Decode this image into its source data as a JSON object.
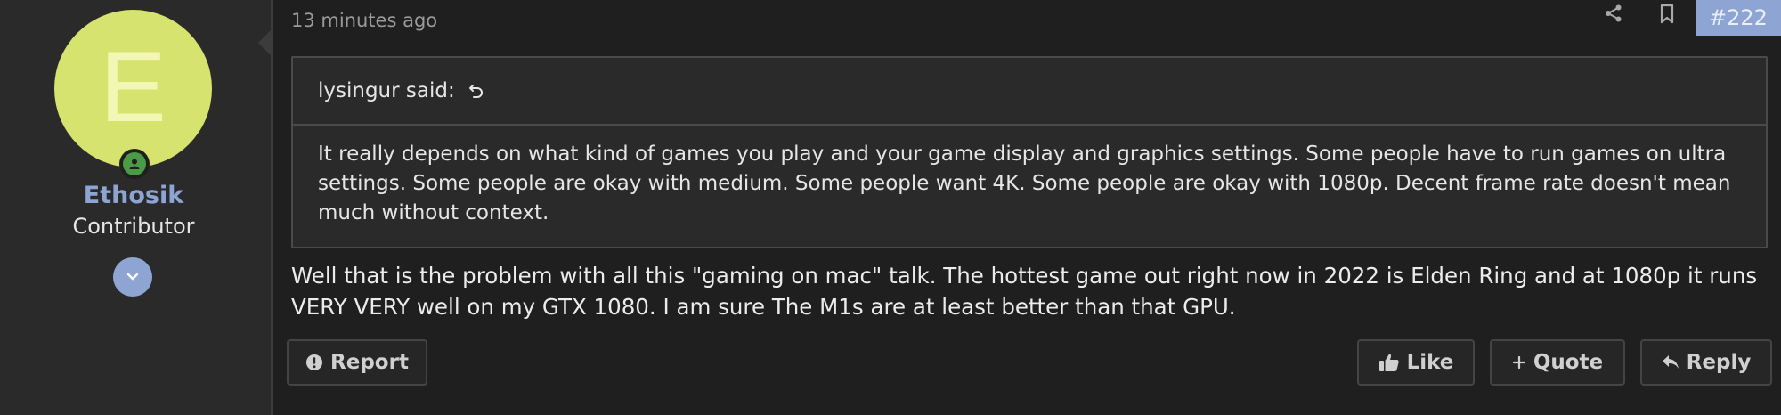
{
  "user": {
    "avatar_letter": "E",
    "username": "Ethosik",
    "title": "Contributor"
  },
  "post": {
    "time": "13 minutes ago",
    "number": "#222",
    "quote": {
      "author_line": "lysingur said:",
      "text": "It really depends on what kind of games you play and your game display and graphics settings. Some people have to run games on ultra settings. Some people are okay with medium. Some people want 4K. Some people are okay with 1080p. Decent frame rate doesn't mean much without context."
    },
    "message": "Well that is the problem with all this \"gaming on mac\" talk. The hottest game out right now in 2022 is Elden Ring and at 1080p it runs VERY VERY well on my GTX 1080. I am sure The M1s are at least better than that GPU."
  },
  "actions": {
    "report_label": "Report",
    "like_label": "Like",
    "quote_label": "Quote",
    "reply_label": "Reply"
  },
  "icons": {
    "share": "share-icon",
    "bookmark": "bookmark-icon",
    "online": "online-status-icon",
    "expand": "chevron-down-icon",
    "report": "exclamation-circle-icon",
    "like": "thumbs-up-icon",
    "quote": "plus-icon",
    "reply": "reply-arrow-icon",
    "quote_jump": "jump-arrow-icon"
  },
  "colors": {
    "accent": "#8ea4d2",
    "avatar_bg": "#d6e36f",
    "online": "#4a9a48",
    "background": "#1f1f1f"
  }
}
